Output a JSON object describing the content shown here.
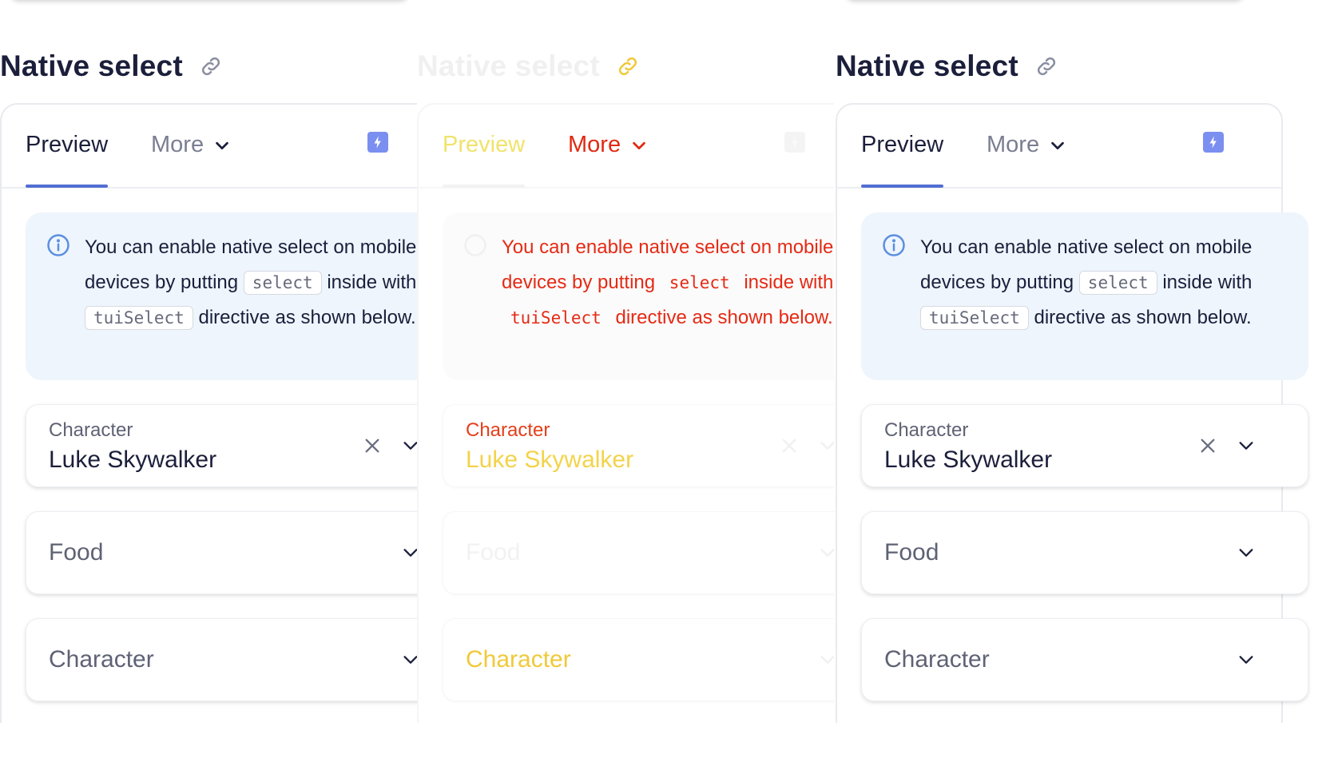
{
  "section": {
    "title": "Native select",
    "tabs": {
      "preview": "Preview",
      "more": "More"
    },
    "notice": {
      "text_before": "You can enable native select on mobile devices by putting",
      "code_select": "select",
      "text_middle": "inside with",
      "code_directive": "tuiSelect",
      "text_after": "directive as shown below."
    },
    "fields": [
      {
        "label": "Character",
        "value": "Luke Skywalker"
      },
      {
        "placeholder": "Food"
      },
      {
        "placeholder": "Character"
      }
    ]
  },
  "icons": {
    "heading": "link-icon",
    "notice": "info-icon",
    "tab_more": "chevron-down-icon",
    "action": "lightning-icon",
    "clear": "close-icon",
    "select_arrow": "chevron-down-icon"
  },
  "colors": {
    "accent": "#526ed3",
    "notice_bg": "#eef5fd",
    "text": "#1b1f3b",
    "muted": "#5e6274",
    "ghost_red": "#e52a14",
    "ghost_yellow": "#f2d14a"
  }
}
